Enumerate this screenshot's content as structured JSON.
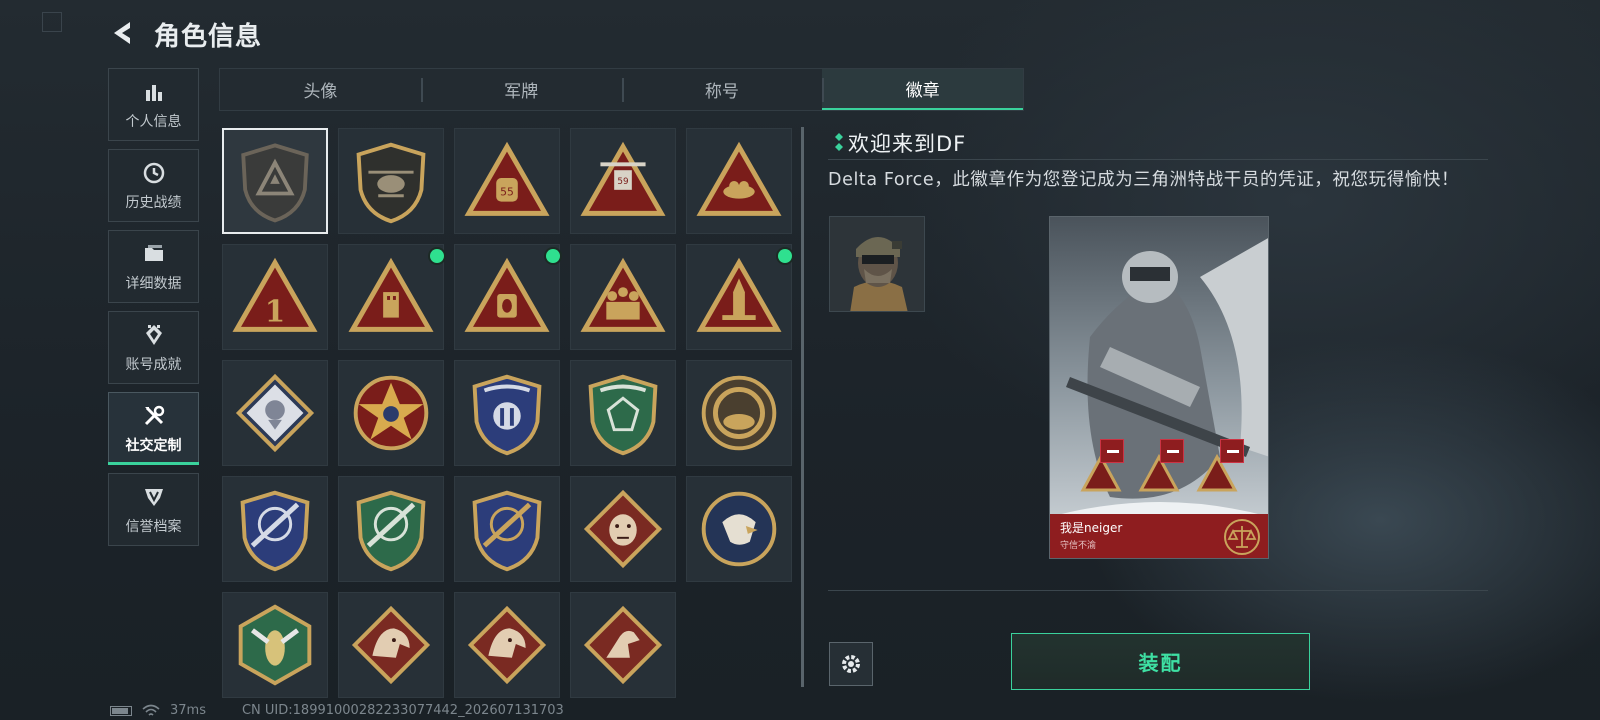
{
  "header": {
    "title": "角色信息"
  },
  "sidebar": {
    "items": [
      {
        "label": "个人信息",
        "icon": "bar-chart-icon"
      },
      {
        "label": "历史战绩",
        "icon": "clock-icon"
      },
      {
        "label": "详细数据",
        "icon": "folder-icon"
      },
      {
        "label": "账号成就",
        "icon": "achievement-icon"
      },
      {
        "label": "社交定制",
        "icon": "tools-icon",
        "active": true
      },
      {
        "label": "信誉档案",
        "icon": "reputation-icon"
      }
    ]
  },
  "tabs": [
    {
      "label": "头像"
    },
    {
      "label": "军牌"
    },
    {
      "label": "称号"
    },
    {
      "label": "徽章",
      "active": true
    }
  ],
  "badges": [
    {
      "name": "delta-logo-badge",
      "selected": true
    },
    {
      "name": "helicopter-badge"
    },
    {
      "name": "bag-55-badge"
    },
    {
      "name": "drone-59-badge"
    },
    {
      "name": "nest-badge"
    },
    {
      "name": "number-one-badge"
    },
    {
      "name": "usb-badge",
      "new": true
    },
    {
      "name": "mask-badge",
      "new": true
    },
    {
      "name": "soldiers-badge"
    },
    {
      "name": "rocket-badge",
      "new": true
    },
    {
      "name": "rose-badge"
    },
    {
      "name": "star-badge"
    },
    {
      "name": "blue-shield-badge"
    },
    {
      "name": "green-gem-badge"
    },
    {
      "name": "oyster-badge"
    },
    {
      "name": "blue-rifle-badge"
    },
    {
      "name": "green-rifle-badge"
    },
    {
      "name": "gold-rifle-badge"
    },
    {
      "name": "bear-badge"
    },
    {
      "name": "eagle-badge"
    },
    {
      "name": "wasp-badge"
    },
    {
      "name": "dragon-badge"
    },
    {
      "name": "dragon-badge-2"
    },
    {
      "name": "runner-badge"
    }
  ],
  "detail": {
    "title": "欢迎来到DF",
    "description": "Delta Force，此徽章作为您登记成为三角洲特战干员的凭证，祝您玩得愉快！",
    "card_name": "我是neiger",
    "card_subtitle": "守信不渝",
    "equip_label": "装配"
  },
  "status": {
    "ping": "37ms",
    "uid": "CN UID:1899100028223307744​2_202607131703"
  },
  "colors": {
    "accent": "#3ad29c",
    "new_dot": "#2fe08f",
    "card_red": "#8e1d1f",
    "badge_gold": "#c9a45c",
    "badge_red": "#7a1d1a"
  }
}
